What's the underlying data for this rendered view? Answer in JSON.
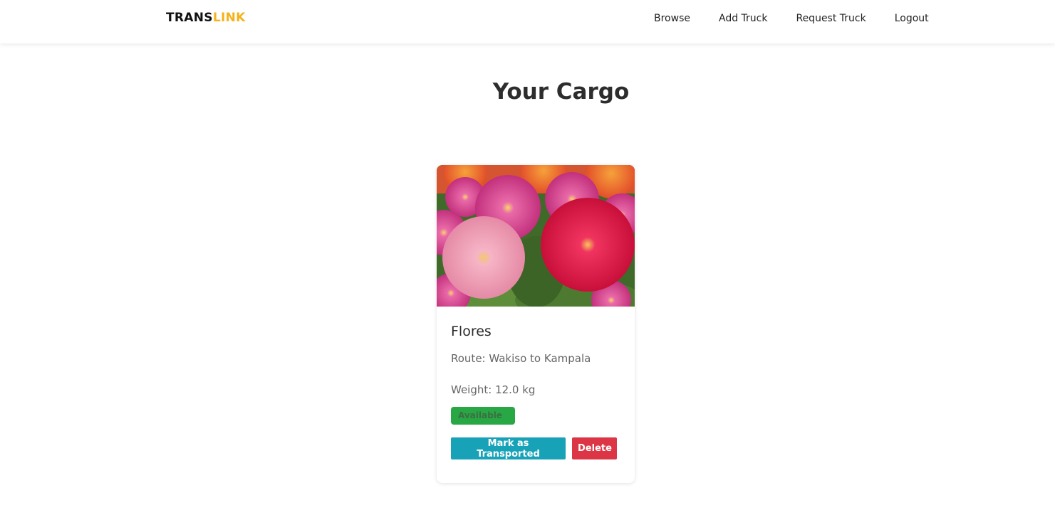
{
  "brand": {
    "part1": "TRANS",
    "part2": "LINK",
    "accent_color": "#f5b21b"
  },
  "nav": {
    "items": [
      {
        "label": "Browse"
      },
      {
        "label": "Add Truck"
      },
      {
        "label": "Request Truck"
      },
      {
        "label": "Logout"
      }
    ]
  },
  "page": {
    "title": "Your Cargo"
  },
  "cargo": {
    "name": "Flores",
    "route": "Route: Wakiso to Kampala",
    "weight": "Weight: 12.0 kg",
    "status": "Available",
    "image_alt": "pink and red zinnia flowers",
    "actions": {
      "mark_label": "Mark as Transported",
      "delete_label": "Delete"
    }
  },
  "colors": {
    "status_green": "#28a745",
    "button_teal": "#17a2b8",
    "button_red": "#dc3545"
  }
}
